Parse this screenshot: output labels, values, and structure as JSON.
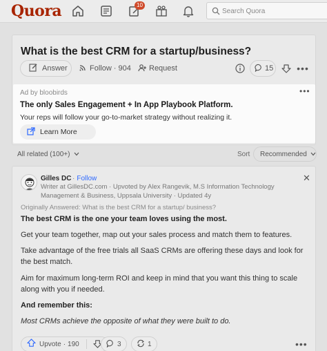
{
  "nav": {
    "logo": "Quora",
    "notification_count": "10",
    "search_placeholder": "Search Quora",
    "icons": [
      "home-icon",
      "following-icon",
      "answer-icon",
      "spaces-icon",
      "notifications-icon",
      "search-icon"
    ]
  },
  "question": {
    "title": "What is the best CRM for a startup/business?",
    "answer_label": "Answer",
    "follow_label": "Follow",
    "follow_count": "904",
    "request_label": "Request",
    "comment_count": "15"
  },
  "ad": {
    "by": "Ad by bloobirds",
    "headline": "The only Sales Engagement + In App Playbook Platform.",
    "body": "Your reps will follow your go-to-market strategy without realizing it.",
    "cta": "Learn More"
  },
  "filter": {
    "all_related": "All related (100+)",
    "sort_label": "Sort",
    "sort_value": "Recommended"
  },
  "answer": {
    "author": "Gilles DC",
    "follow": "Follow",
    "credentials": "Writer at GillesDC.com · Upvoted by Alex Rangevik, M.S Information Technology Management & Business, Uppsala University · Updated 4y",
    "originally": "Originally Answered: What is the best CRM for a startup/ business?",
    "p1": "The best CRM is the one your team loves using the most.",
    "p2": "Get your team together, map out your sales process and match them to features.",
    "p3": "Take advantage of the free trials all SaaS CRMs are offering these days and look for the best match.",
    "p4": "Aim for maximum long-term ROI and keep in mind that you want this thing to scale along with you if needed.",
    "p5": "And remember this:",
    "p6": "Most CRMs achieve the opposite of what they were built to do.",
    "upvote_label": "Upvote",
    "upvote_count": "190",
    "comment_count": "3",
    "share_count": "1"
  },
  "colors": {
    "brand": "#a82400",
    "badge": "#cf4a2a",
    "link": "#2e69ff"
  }
}
